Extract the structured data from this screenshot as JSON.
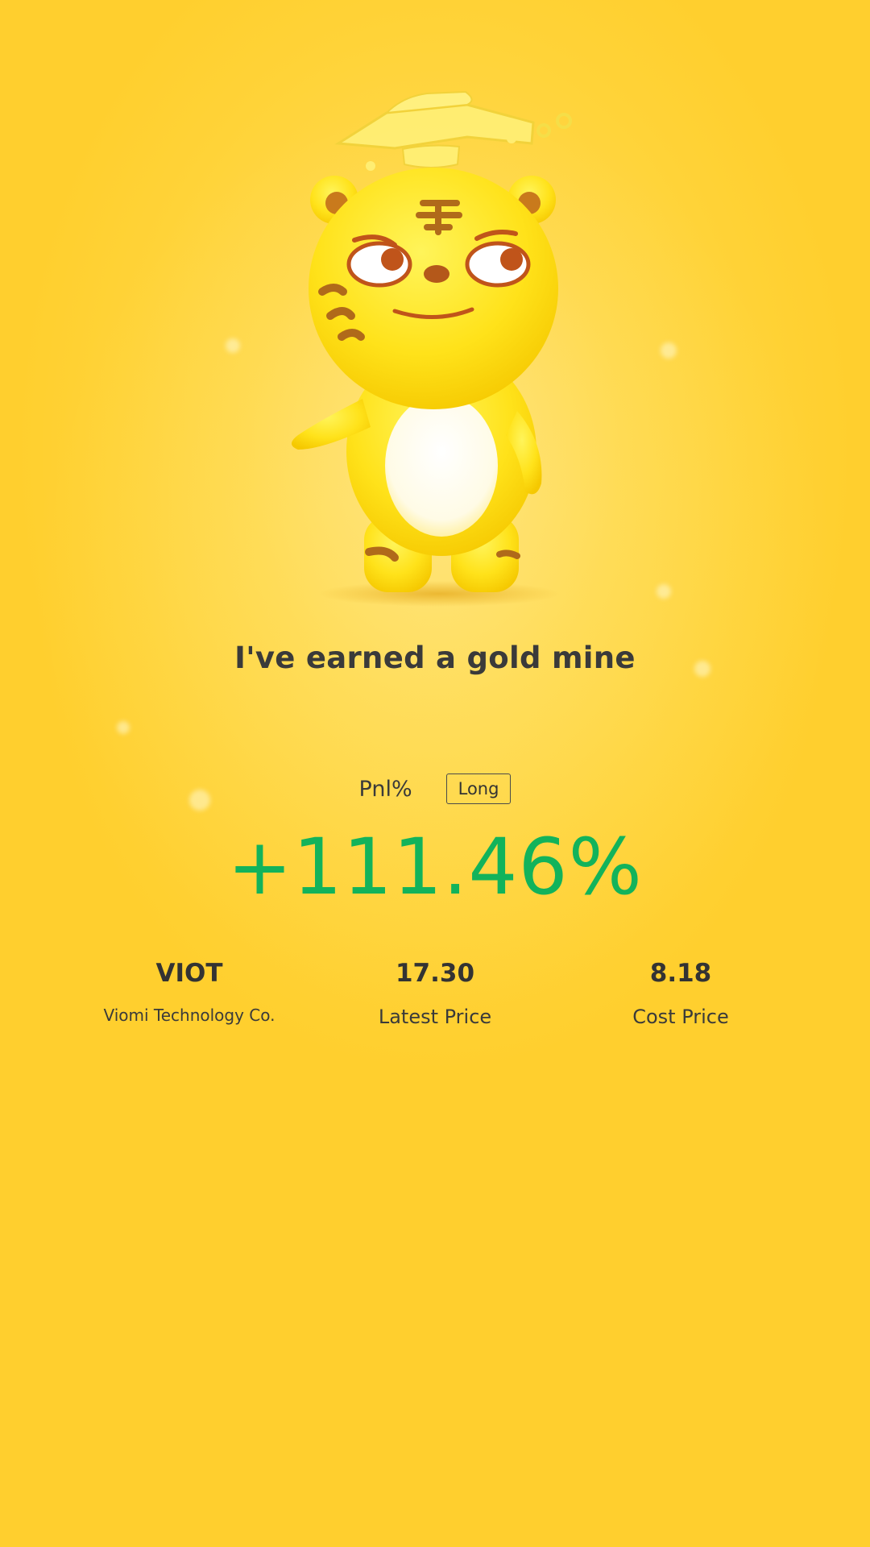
{
  "headline": "I've earned a gold mine",
  "pnl": {
    "label": "Pnl%",
    "direction": "Long",
    "value": "+111.46%"
  },
  "stats": [
    {
      "value": "VIOT",
      "label": "Viomi Technology Co."
    },
    {
      "value": "17.30",
      "label": "Latest Price"
    },
    {
      "value": "8.18",
      "label": "Cost Price"
    }
  ],
  "colors": {
    "gain": "#12b35b",
    "background": "#ffd338",
    "text": "#3a3a3a"
  },
  "icons": {
    "mascot": "tiger-mascot-illustration"
  }
}
